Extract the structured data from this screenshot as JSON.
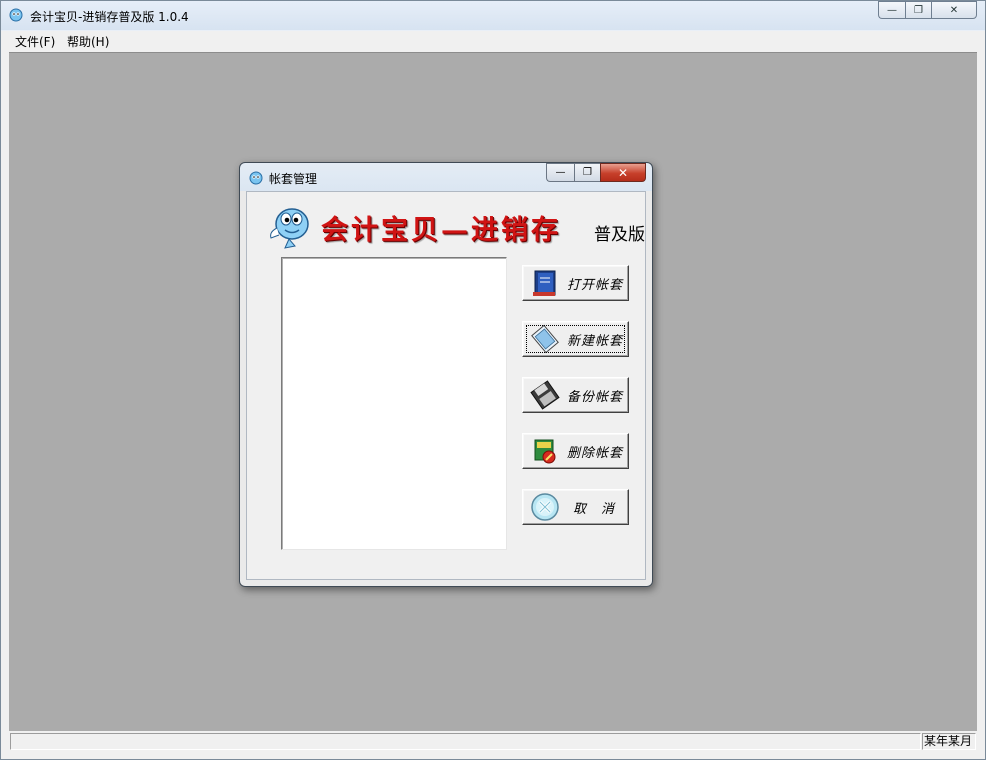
{
  "app": {
    "title": "会计宝贝-进销存普及版 1.0.4",
    "menu": [
      {
        "label": "文件(F)"
      },
      {
        "label": "帮助(H)"
      }
    ]
  },
  "statusbar": {
    "period": "某年某月"
  },
  "dialog": {
    "title": "帐套管理",
    "banner_title": "会计宝贝—进销存",
    "banner_edition": "普及版",
    "buttons": [
      {
        "label": "打开帐套",
        "icon": "book-icon"
      },
      {
        "label": "新建帐套",
        "icon": "new-ledger-icon"
      },
      {
        "label": "备份帐套",
        "icon": "floppy-disk-icon"
      },
      {
        "label": "删除帐套",
        "icon": "delete-ledger-icon"
      },
      {
        "label": "取　消",
        "icon": "cancel-circle-icon"
      }
    ]
  }
}
